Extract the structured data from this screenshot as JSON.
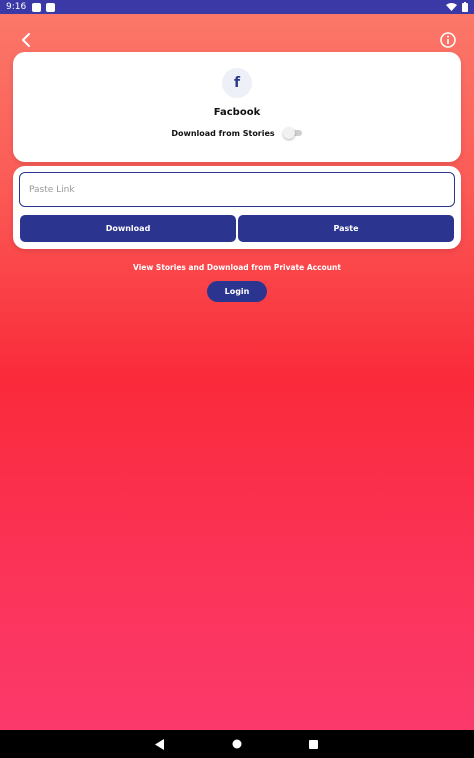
{
  "status_bar": {
    "time": "9:16"
  },
  "header": {
    "back_icon": "chevron-left-icon",
    "info_icon": "info-circle-icon"
  },
  "platform_card": {
    "logo_letter": "f",
    "title": "Facbook",
    "toggle_label": "Download from Stories",
    "toggle_on": false
  },
  "link_card": {
    "placeholder": "Paste Link",
    "download_label": "Download",
    "paste_label": "Paste"
  },
  "private": {
    "text": "View Stories and Download from Private Account",
    "login_label": "Login"
  },
  "colors": {
    "accent": "#2b3590",
    "status_bar": "#3b39a6"
  }
}
